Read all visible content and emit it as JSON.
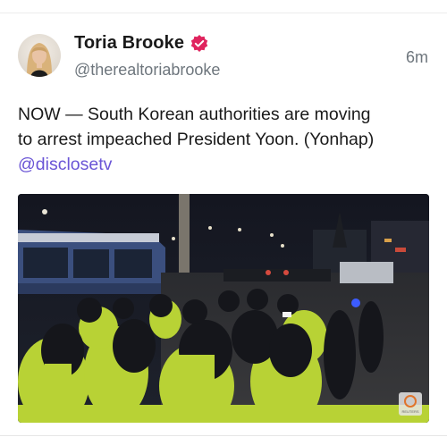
{
  "post": {
    "author_name": "Toria Brooke",
    "author_handle": "@therealtoriabrooke",
    "timestamp": "6m",
    "text_line1": "NOW — South Korean authorities are moving",
    "text_line2": "to arrest impeached President Yoon. (Yonhap)",
    "mention": "@disclosetv",
    "verified": true,
    "media": {
      "type": "video-still",
      "watermark": "REUTERS"
    }
  },
  "colors": {
    "verified_badge": "#e0245e",
    "mention": "#6a55d6",
    "secondary_text": "#6e767d"
  },
  "icons": [
    "avatar",
    "verified-badge-icon",
    "reuters-watermark-icon"
  ]
}
